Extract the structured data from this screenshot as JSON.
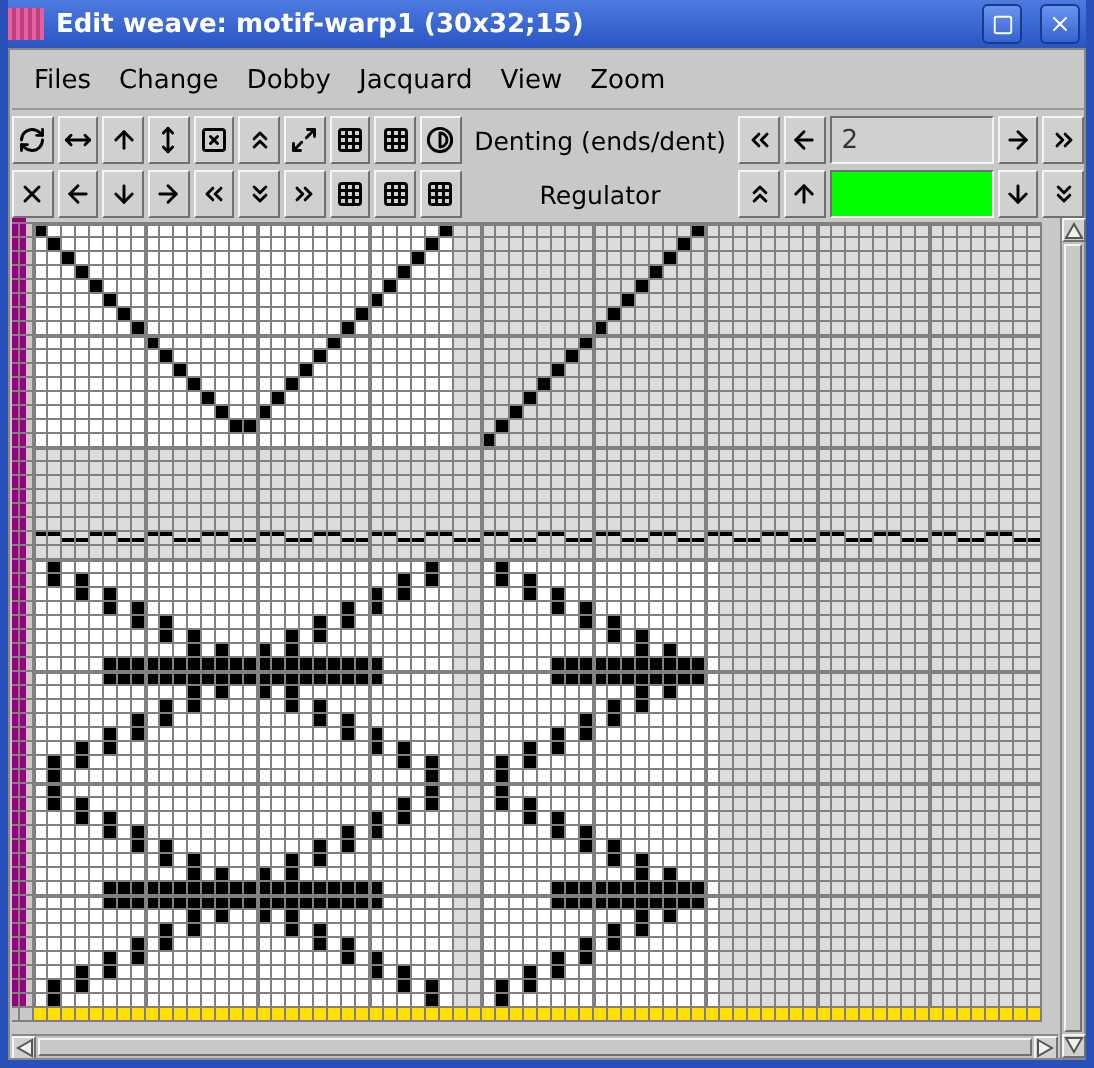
{
  "window": {
    "title": "Edit weave: motif-warp1 (30x32;15)"
  },
  "menu": [
    {
      "label": "Files"
    },
    {
      "label": "Change"
    },
    {
      "label": "Dobby"
    },
    {
      "label": "Jacquard"
    },
    {
      "label": "View"
    },
    {
      "label": "Zoom"
    }
  ],
  "denting": {
    "label": "Denting (ends/dent)",
    "value": "2"
  },
  "regulator": {
    "label": "Regulator"
  }
}
